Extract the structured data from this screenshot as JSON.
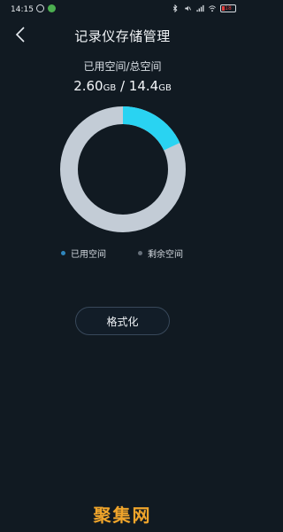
{
  "status_bar": {
    "time": "14:15",
    "battery": "18",
    "icons": [
      "alarm-icon",
      "app-notification-icon",
      "bluetooth-icon",
      "mute-icon",
      "signal-icon",
      "wifi-icon",
      "battery-icon"
    ]
  },
  "header": {
    "title": "记录仪存储管理",
    "back_icon": "chevron-left-icon"
  },
  "storage": {
    "label": "已用空间/总空间",
    "used_value": "2.60",
    "used_unit": "GB",
    "separator": " / ",
    "total_value": "14.4",
    "total_unit": "GB",
    "used_gb": 2.6,
    "total_gb": 14.4
  },
  "legend": {
    "used_label": "已用空间",
    "free_label": "剩余空间"
  },
  "colors": {
    "used": "#29d3f2",
    "free": "#c3ccd6",
    "used_dot": "#2f86bd",
    "free_dot": "#66707a",
    "background": "#111a22",
    "watermark": "#f0a52b"
  },
  "actions": {
    "format_label": "格式化"
  },
  "watermark": {
    "text": "聚集网"
  }
}
